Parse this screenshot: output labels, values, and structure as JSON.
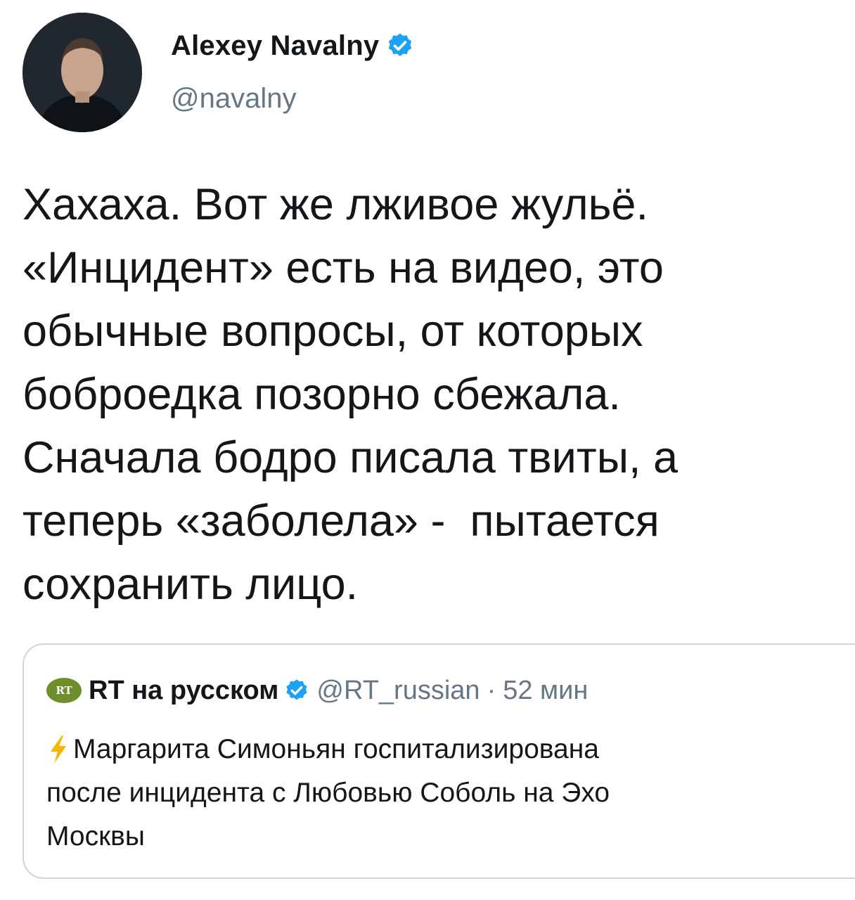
{
  "tweet": {
    "author": {
      "name": "Alexey Navalny",
      "handle": "@navalny",
      "avatar_icon": "profile-photo",
      "verified_icon": "verified-badge-icon",
      "verified_color": "#1da1f2"
    },
    "text_lines": [
      "Хахаха. Вот же лживое жульё.",
      "«Инцидент» есть на видео, это",
      "обычные вопросы, от которых",
      "боброедка позорно сбежала.",
      "Сначала бодро писала твиты, а",
      "теперь «заболела» -  пытается",
      "сохранить лицо."
    ],
    "quoted_tweet": {
      "author_logo_text": "RT",
      "author_logo_color": "#6f8f2c",
      "author_name": "RT на русском",
      "verified_icon": "verified-badge-icon",
      "handle": "@RT_russian",
      "separator": "·",
      "time": "52 мин",
      "emoji_icon": "lightning-bolt-icon",
      "emoji_color": "#f5b700",
      "text_lines": [
        "Маргарита Симоньян госпитализирована",
        "после инцидента с Любовью Соболь на Эхо",
        "Москвы"
      ]
    }
  }
}
